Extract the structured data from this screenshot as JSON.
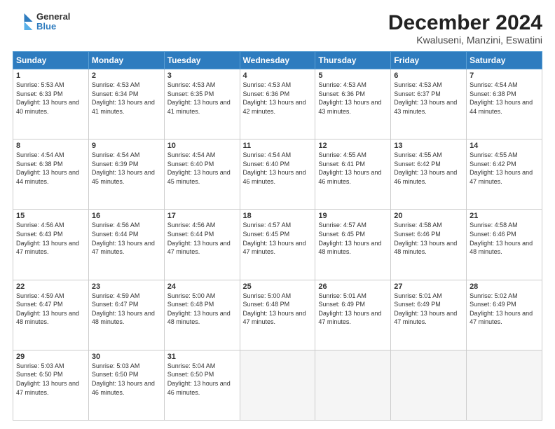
{
  "header": {
    "logo_line1": "General",
    "logo_line2": "Blue",
    "title": "December 2024",
    "subtitle": "Kwaluseni, Manzini, Eswatini"
  },
  "weekdays": [
    "Sunday",
    "Monday",
    "Tuesday",
    "Wednesday",
    "Thursday",
    "Friday",
    "Saturday"
  ],
  "weeks": [
    [
      {
        "day": 1,
        "sunrise": "5:53 AM",
        "sunset": "6:33 PM",
        "daylight": "13 hours and 40 minutes."
      },
      {
        "day": 2,
        "sunrise": "4:53 AM",
        "sunset": "6:34 PM",
        "daylight": "13 hours and 41 minutes."
      },
      {
        "day": 3,
        "sunrise": "4:53 AM",
        "sunset": "6:35 PM",
        "daylight": "13 hours and 41 minutes."
      },
      {
        "day": 4,
        "sunrise": "4:53 AM",
        "sunset": "6:36 PM",
        "daylight": "13 hours and 42 minutes."
      },
      {
        "day": 5,
        "sunrise": "4:53 AM",
        "sunset": "6:36 PM",
        "daylight": "13 hours and 43 minutes."
      },
      {
        "day": 6,
        "sunrise": "4:53 AM",
        "sunset": "6:37 PM",
        "daylight": "13 hours and 43 minutes."
      },
      {
        "day": 7,
        "sunrise": "4:54 AM",
        "sunset": "6:38 PM",
        "daylight": "13 hours and 44 minutes."
      }
    ],
    [
      {
        "day": 8,
        "sunrise": "4:54 AM",
        "sunset": "6:38 PM",
        "daylight": "13 hours and 44 minutes."
      },
      {
        "day": 9,
        "sunrise": "4:54 AM",
        "sunset": "6:39 PM",
        "daylight": "13 hours and 45 minutes."
      },
      {
        "day": 10,
        "sunrise": "4:54 AM",
        "sunset": "6:40 PM",
        "daylight": "13 hours and 45 minutes."
      },
      {
        "day": 11,
        "sunrise": "4:54 AM",
        "sunset": "6:40 PM",
        "daylight": "13 hours and 46 minutes."
      },
      {
        "day": 12,
        "sunrise": "4:55 AM",
        "sunset": "6:41 PM",
        "daylight": "13 hours and 46 minutes."
      },
      {
        "day": 13,
        "sunrise": "4:55 AM",
        "sunset": "6:42 PM",
        "daylight": "13 hours and 46 minutes."
      },
      {
        "day": 14,
        "sunrise": "4:55 AM",
        "sunset": "6:42 PM",
        "daylight": "13 hours and 47 minutes."
      }
    ],
    [
      {
        "day": 15,
        "sunrise": "4:56 AM",
        "sunset": "6:43 PM",
        "daylight": "13 hours and 47 minutes."
      },
      {
        "day": 16,
        "sunrise": "4:56 AM",
        "sunset": "6:44 PM",
        "daylight": "13 hours and 47 minutes."
      },
      {
        "day": 17,
        "sunrise": "4:56 AM",
        "sunset": "6:44 PM",
        "daylight": "13 hours and 47 minutes."
      },
      {
        "day": 18,
        "sunrise": "4:57 AM",
        "sunset": "6:45 PM",
        "daylight": "13 hours and 47 minutes."
      },
      {
        "day": 19,
        "sunrise": "4:57 AM",
        "sunset": "6:45 PM",
        "daylight": "13 hours and 48 minutes."
      },
      {
        "day": 20,
        "sunrise": "4:58 AM",
        "sunset": "6:46 PM",
        "daylight": "13 hours and 48 minutes."
      },
      {
        "day": 21,
        "sunrise": "4:58 AM",
        "sunset": "6:46 PM",
        "daylight": "13 hours and 48 minutes."
      }
    ],
    [
      {
        "day": 22,
        "sunrise": "4:59 AM",
        "sunset": "6:47 PM",
        "daylight": "13 hours and 48 minutes."
      },
      {
        "day": 23,
        "sunrise": "4:59 AM",
        "sunset": "6:47 PM",
        "daylight": "13 hours and 48 minutes."
      },
      {
        "day": 24,
        "sunrise": "5:00 AM",
        "sunset": "6:48 PM",
        "daylight": "13 hours and 48 minutes."
      },
      {
        "day": 25,
        "sunrise": "5:00 AM",
        "sunset": "6:48 PM",
        "daylight": "13 hours and 47 minutes."
      },
      {
        "day": 26,
        "sunrise": "5:01 AM",
        "sunset": "6:49 PM",
        "daylight": "13 hours and 47 minutes."
      },
      {
        "day": 27,
        "sunrise": "5:01 AM",
        "sunset": "6:49 PM",
        "daylight": "13 hours and 47 minutes."
      },
      {
        "day": 28,
        "sunrise": "5:02 AM",
        "sunset": "6:49 PM",
        "daylight": "13 hours and 47 minutes."
      }
    ],
    [
      {
        "day": 29,
        "sunrise": "5:03 AM",
        "sunset": "6:50 PM",
        "daylight": "13 hours and 47 minutes."
      },
      {
        "day": 30,
        "sunrise": "5:03 AM",
        "sunset": "6:50 PM",
        "daylight": "13 hours and 46 minutes."
      },
      {
        "day": 31,
        "sunrise": "5:04 AM",
        "sunset": "6:50 PM",
        "daylight": "13 hours and 46 minutes."
      },
      null,
      null,
      null,
      null
    ]
  ]
}
